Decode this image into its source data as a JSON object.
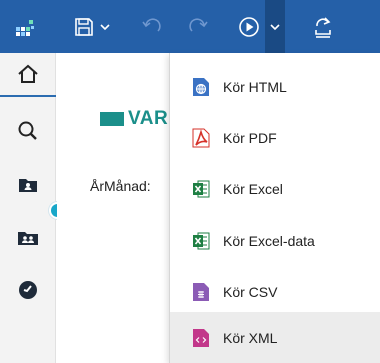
{
  "toolbar": {
    "color": "#2560a8",
    "icons": [
      "app-grid-icon",
      "save-icon",
      "chevron-down-icon",
      "undo-icon",
      "redo-icon",
      "run-icon",
      "chevron-down-icon",
      "share-icon"
    ]
  },
  "rail": {
    "items": [
      {
        "name": "home",
        "icon": "home-icon",
        "active": true
      },
      {
        "name": "search",
        "icon": "search-icon"
      },
      {
        "name": "team-content",
        "icon": "folder-person-icon"
      },
      {
        "name": "shared-content",
        "icon": "folder-people-icon"
      },
      {
        "name": "recent",
        "icon": "clock-icon"
      }
    ],
    "accent": "#18a7c9"
  },
  "report": {
    "logo_text": "VAR",
    "logo_color": "#1b8f8a",
    "month_label": "ÅrMånad:"
  },
  "run_menu": {
    "items": [
      {
        "label": "Kör HTML",
        "icon": "globe-icon",
        "color": "#3a72c4"
      },
      {
        "label": "Kör PDF",
        "icon": "pdf-icon",
        "color": "#d6322a"
      },
      {
        "label": "Kör Excel",
        "icon": "excel-icon",
        "color": "#1e7f43"
      },
      {
        "label": "Kör Excel-data",
        "icon": "excel-data-icon",
        "color": "#1e7f43"
      },
      {
        "label": "Kör CSV",
        "icon": "csv-icon",
        "color": "#8b5bb5"
      },
      {
        "label": "Kör XML",
        "icon": "xml-icon",
        "color": "#c2378a",
        "hovered": true
      }
    ]
  }
}
